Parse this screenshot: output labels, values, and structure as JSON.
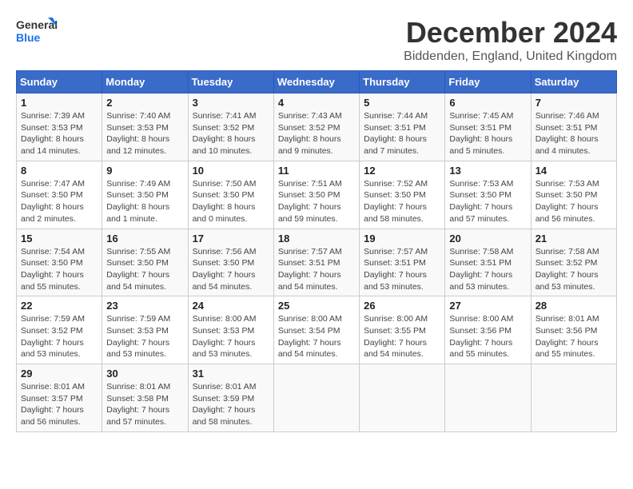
{
  "header": {
    "logo_line1": "General",
    "logo_line2": "Blue",
    "month_year": "December 2024",
    "location": "Biddenden, England, United Kingdom"
  },
  "weekdays": [
    "Sunday",
    "Monday",
    "Tuesday",
    "Wednesday",
    "Thursday",
    "Friday",
    "Saturday"
  ],
  "weeks": [
    [
      {
        "day": "1",
        "info": "Sunrise: 7:39 AM\nSunset: 3:53 PM\nDaylight: 8 hours\nand 14 minutes."
      },
      {
        "day": "2",
        "info": "Sunrise: 7:40 AM\nSunset: 3:53 PM\nDaylight: 8 hours\nand 12 minutes."
      },
      {
        "day": "3",
        "info": "Sunrise: 7:41 AM\nSunset: 3:52 PM\nDaylight: 8 hours\nand 10 minutes."
      },
      {
        "day": "4",
        "info": "Sunrise: 7:43 AM\nSunset: 3:52 PM\nDaylight: 8 hours\nand 9 minutes."
      },
      {
        "day": "5",
        "info": "Sunrise: 7:44 AM\nSunset: 3:51 PM\nDaylight: 8 hours\nand 7 minutes."
      },
      {
        "day": "6",
        "info": "Sunrise: 7:45 AM\nSunset: 3:51 PM\nDaylight: 8 hours\nand 5 minutes."
      },
      {
        "day": "7",
        "info": "Sunrise: 7:46 AM\nSunset: 3:51 PM\nDaylight: 8 hours\nand 4 minutes."
      }
    ],
    [
      {
        "day": "8",
        "info": "Sunrise: 7:47 AM\nSunset: 3:50 PM\nDaylight: 8 hours\nand 2 minutes."
      },
      {
        "day": "9",
        "info": "Sunrise: 7:49 AM\nSunset: 3:50 PM\nDaylight: 8 hours\nand 1 minute."
      },
      {
        "day": "10",
        "info": "Sunrise: 7:50 AM\nSunset: 3:50 PM\nDaylight: 8 hours\nand 0 minutes."
      },
      {
        "day": "11",
        "info": "Sunrise: 7:51 AM\nSunset: 3:50 PM\nDaylight: 7 hours\nand 59 minutes."
      },
      {
        "day": "12",
        "info": "Sunrise: 7:52 AM\nSunset: 3:50 PM\nDaylight: 7 hours\nand 58 minutes."
      },
      {
        "day": "13",
        "info": "Sunrise: 7:53 AM\nSunset: 3:50 PM\nDaylight: 7 hours\nand 57 minutes."
      },
      {
        "day": "14",
        "info": "Sunrise: 7:53 AM\nSunset: 3:50 PM\nDaylight: 7 hours\nand 56 minutes."
      }
    ],
    [
      {
        "day": "15",
        "info": "Sunrise: 7:54 AM\nSunset: 3:50 PM\nDaylight: 7 hours\nand 55 minutes."
      },
      {
        "day": "16",
        "info": "Sunrise: 7:55 AM\nSunset: 3:50 PM\nDaylight: 7 hours\nand 54 minutes."
      },
      {
        "day": "17",
        "info": "Sunrise: 7:56 AM\nSunset: 3:50 PM\nDaylight: 7 hours\nand 54 minutes."
      },
      {
        "day": "18",
        "info": "Sunrise: 7:57 AM\nSunset: 3:51 PM\nDaylight: 7 hours\nand 54 minutes."
      },
      {
        "day": "19",
        "info": "Sunrise: 7:57 AM\nSunset: 3:51 PM\nDaylight: 7 hours\nand 53 minutes."
      },
      {
        "day": "20",
        "info": "Sunrise: 7:58 AM\nSunset: 3:51 PM\nDaylight: 7 hours\nand 53 minutes."
      },
      {
        "day": "21",
        "info": "Sunrise: 7:58 AM\nSunset: 3:52 PM\nDaylight: 7 hours\nand 53 minutes."
      }
    ],
    [
      {
        "day": "22",
        "info": "Sunrise: 7:59 AM\nSunset: 3:52 PM\nDaylight: 7 hours\nand 53 minutes."
      },
      {
        "day": "23",
        "info": "Sunrise: 7:59 AM\nSunset: 3:53 PM\nDaylight: 7 hours\nand 53 minutes."
      },
      {
        "day": "24",
        "info": "Sunrise: 8:00 AM\nSunset: 3:53 PM\nDaylight: 7 hours\nand 53 minutes."
      },
      {
        "day": "25",
        "info": "Sunrise: 8:00 AM\nSunset: 3:54 PM\nDaylight: 7 hours\nand 54 minutes."
      },
      {
        "day": "26",
        "info": "Sunrise: 8:00 AM\nSunset: 3:55 PM\nDaylight: 7 hours\nand 54 minutes."
      },
      {
        "day": "27",
        "info": "Sunrise: 8:00 AM\nSunset: 3:56 PM\nDaylight: 7 hours\nand 55 minutes."
      },
      {
        "day": "28",
        "info": "Sunrise: 8:01 AM\nSunset: 3:56 PM\nDaylight: 7 hours\nand 55 minutes."
      }
    ],
    [
      {
        "day": "29",
        "info": "Sunrise: 8:01 AM\nSunset: 3:57 PM\nDaylight: 7 hours\nand 56 minutes."
      },
      {
        "day": "30",
        "info": "Sunrise: 8:01 AM\nSunset: 3:58 PM\nDaylight: 7 hours\nand 57 minutes."
      },
      {
        "day": "31",
        "info": "Sunrise: 8:01 AM\nSunset: 3:59 PM\nDaylight: 7 hours\nand 58 minutes."
      },
      null,
      null,
      null,
      null
    ]
  ]
}
